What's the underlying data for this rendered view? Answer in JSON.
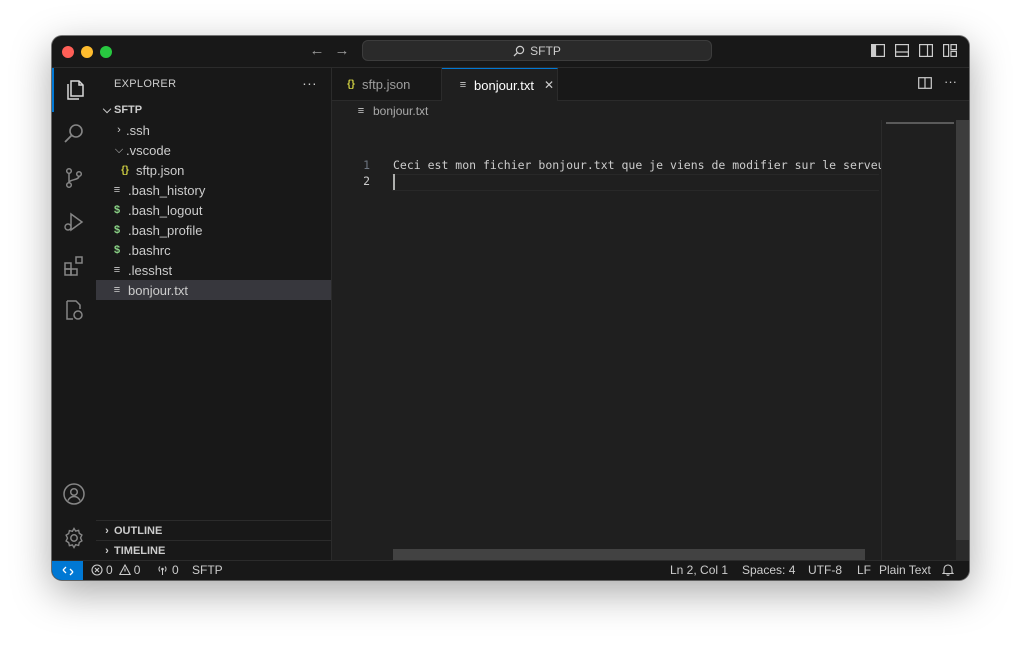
{
  "titlebar": {
    "search_label": "SFTP"
  },
  "sidebar": {
    "title": "EXPLORER",
    "more": "···",
    "root": "SFTP",
    "tree": [
      {
        "label": ".ssh",
        "type": "folder",
        "expanded": false
      },
      {
        "label": ".vscode",
        "type": "folder",
        "expanded": true
      },
      {
        "label": "sftp.json",
        "type": "json-file"
      },
      {
        "label": ".bash_history",
        "type": "text-file"
      },
      {
        "label": ".bash_logout",
        "type": "shell-file"
      },
      {
        "label": ".bash_profile",
        "type": "shell-file"
      },
      {
        "label": ".bashrc",
        "type": "shell-file"
      },
      {
        "label": ".lesshst",
        "type": "text-file"
      },
      {
        "label": "bonjour.txt",
        "type": "text-file",
        "selected": true
      }
    ],
    "outline": "OUTLINE",
    "timeline": "TIMELINE"
  },
  "editor": {
    "tabs": [
      {
        "label": "sftp.json",
        "icon": "{}",
        "active": false
      },
      {
        "label": "bonjour.txt",
        "icon": "≡",
        "active": true,
        "close": "✕"
      }
    ],
    "breadcrumb": "bonjour.txt",
    "lines": [
      {
        "num": "1",
        "text": "Ceci est mon fichier bonjour.txt que je viens de modifier sur le serveur"
      },
      {
        "num": "2",
        "text": ""
      }
    ]
  },
  "statusbar": {
    "errors": "0",
    "warnings": "0",
    "ports": "0",
    "remote_name": "SFTP",
    "position": "Ln 2, Col 1",
    "spaces": "Spaces: 4",
    "encoding": "UTF-8",
    "eol": "LF",
    "language": "Plain Text"
  },
  "colors": {
    "accent": "#0078d4",
    "json_icon": "#cbcb41",
    "shell_icon": "#89d185"
  }
}
